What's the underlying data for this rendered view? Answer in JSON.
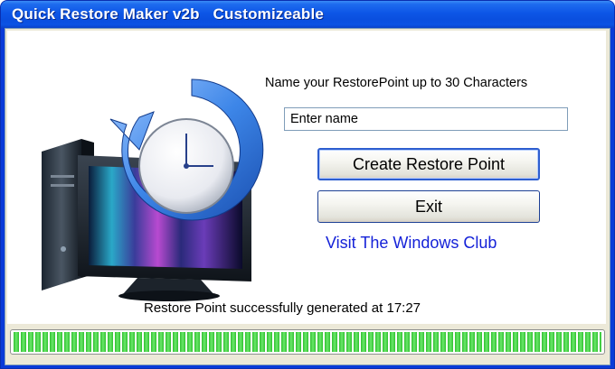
{
  "window": {
    "title": "Quick Restore Maker v2b   Customizeable"
  },
  "form": {
    "prompt": "Name your RestorePoint up to 30  Characters",
    "name_value": "Enter name",
    "create_label": "Create Restore Point",
    "exit_label": "Exit",
    "link_label": "Visit The Windows Club"
  },
  "status": {
    "message": "Restore Point successfully generated at 17:27",
    "progress_percent": 100
  },
  "colors": {
    "titlebar": "#0a4fdf",
    "link": "#1522d8",
    "progress_fill": "#30c030"
  },
  "icons": {
    "illustration": "restore-clock-computer-icon"
  }
}
